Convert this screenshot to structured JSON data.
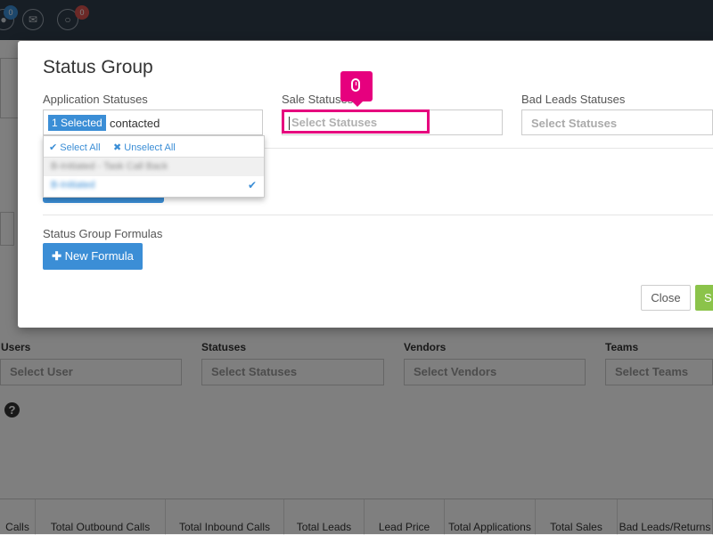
{
  "topbar": {
    "badges": [
      "0",
      "0"
    ]
  },
  "background": {
    "filters": [
      {
        "label": "Users",
        "placeholder": "Select User"
      },
      {
        "label": "Statuses",
        "placeholder": "Select Statuses"
      },
      {
        "label": "Vendors",
        "placeholder": "Select Vendors"
      },
      {
        "label": "Teams",
        "placeholder": "Select Teams"
      }
    ],
    "help_icon": "?",
    "table_headers": [
      "Calls",
      "Total Outbound Calls",
      "Total Inbound Calls",
      "Total Leads",
      "Lead Price",
      "Total Applications",
      "Total Sales",
      "Bad Leads/Returns"
    ]
  },
  "modal": {
    "title": "Status Group",
    "application_statuses": {
      "label": "Application Statuses",
      "tag": "1 Selected",
      "value": "contacted",
      "dropdown": {
        "select_all": "Select All",
        "unselect_all": "Unselect All",
        "items": [
          {
            "label": "B-Initiated - Task Call Back",
            "selected": false
          },
          {
            "label": "B-Initiated",
            "selected": true
          }
        ]
      }
    },
    "sale_statuses": {
      "label": "Sale Statuses",
      "placeholder": "Select Statuses"
    },
    "bad_leads_statuses": {
      "label": "Bad Leads Statuses",
      "placeholder": "Select Statuses"
    },
    "formulas": {
      "label": "Status Group Formulas",
      "new_button": "New Formula"
    },
    "close_button": "Close",
    "save_button": "S"
  },
  "colors": {
    "primary": "#3b8ed6",
    "success": "#8bc34a",
    "highlight": "#e6007e",
    "topbar": "#2f3c4a"
  },
  "icons": {
    "mouse": "mouse-icon",
    "check": "check-icon",
    "times": "times-icon",
    "plus": "plus-icon"
  }
}
